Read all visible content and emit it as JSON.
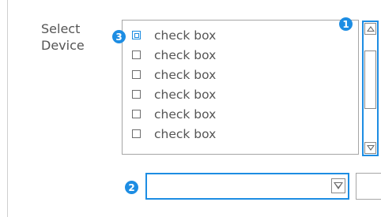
{
  "field": {
    "label": "Select\nDevice"
  },
  "listbox": {
    "items": [
      {
        "label": "check  box",
        "checked": false,
        "focused": true
      },
      {
        "label": "check  box",
        "checked": false,
        "focused": false
      },
      {
        "label": "check  box",
        "checked": false,
        "focused": false
      },
      {
        "label": "check  box",
        "checked": false,
        "focused": false
      },
      {
        "label": "check  box",
        "checked": false,
        "focused": false
      },
      {
        "label": "check  box",
        "checked": false,
        "focused": false
      }
    ]
  },
  "dropdown": {
    "value": ""
  },
  "badges": {
    "scrollbar": "1",
    "dropdown": "2",
    "first_item": "3"
  },
  "colors": {
    "accent": "#1d8de3",
    "text": "#555555",
    "border": "#a6a6a6"
  },
  "icons": {
    "scroll_up": "triangle-up-icon",
    "scroll_down": "triangle-down-icon",
    "dropdown_arrow": "triangle-down-icon"
  }
}
